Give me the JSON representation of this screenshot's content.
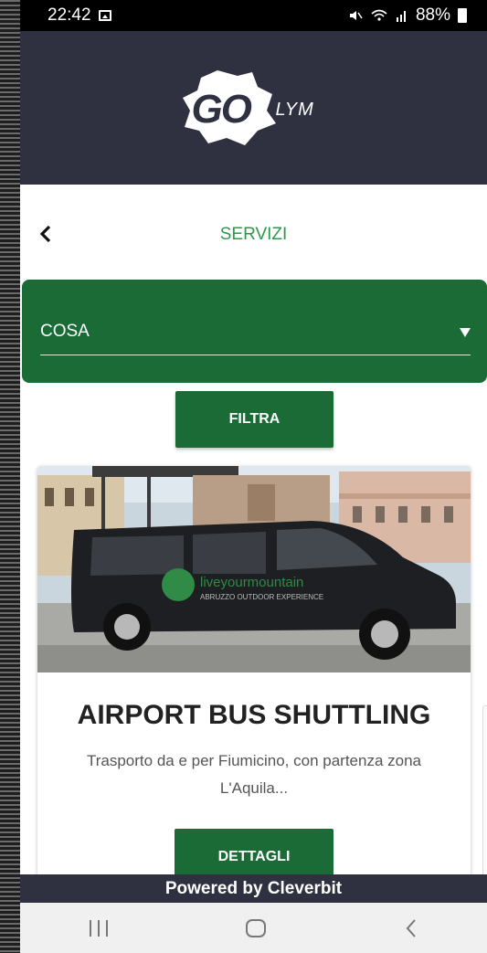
{
  "statusbar": {
    "time": "22:42",
    "battery": "88%"
  },
  "header": {
    "logo_go": "GO",
    "logo_suffix": "LYM"
  },
  "page": {
    "title": "SERVIZI"
  },
  "filter": {
    "select_label": "COSA",
    "button_label": "FILTRA"
  },
  "card": {
    "title": "AIRPORT BUS SHUTTLING",
    "description": "Trasporto da e per Fiumicino, con partenza zona L'Aquila...",
    "button_label": "DETTAGLI",
    "photo_text_brand": "liveyourmountain",
    "photo_text_sub": "ABRUZZO OUTDOOR EXPERIENCE"
  },
  "footer": {
    "text": "Powered by Cleverbit"
  },
  "colors": {
    "accent_green": "#1a6b35",
    "title_green": "#2a9a4a",
    "header_dark": "#2f3140"
  },
  "icons": [
    "gallery-icon",
    "mute-icon",
    "wifi-icon",
    "signal-icon",
    "battery-icon",
    "back-arrow-icon",
    "dropdown-arrow-icon",
    "recent-apps-icon",
    "home-icon",
    "nav-back-icon"
  ]
}
